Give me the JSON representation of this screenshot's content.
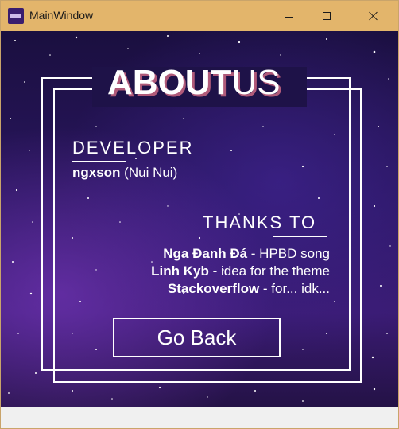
{
  "window": {
    "title": "MainWindow"
  },
  "about": {
    "heading_bold": "ABOUT",
    "heading_light": "US",
    "developer_label": "DEVELOPER",
    "developer_name": "ngxson",
    "developer_nick": " (Nui Nui)",
    "thanks_label": "THANKS TO",
    "credits": [
      {
        "name": "Nga Đanh Đá",
        "note": " - HPBD song"
      },
      {
        "name": "Linh Kyb",
        "note": " - idea for the theme"
      },
      {
        "name": "Stackoverflow",
        "note": " - for... idk..."
      }
    ],
    "go_back_label": "Go Back"
  },
  "colors": {
    "titlebar": "#e3b56b",
    "shadow": "#b05a79",
    "bg_top": "#1a0f3f",
    "bg_mid": "#3a1b73"
  },
  "icons": {
    "app": "app-logo-icon",
    "minimize": "minimize-icon",
    "maximize": "maximize-icon",
    "close": "close-icon"
  }
}
